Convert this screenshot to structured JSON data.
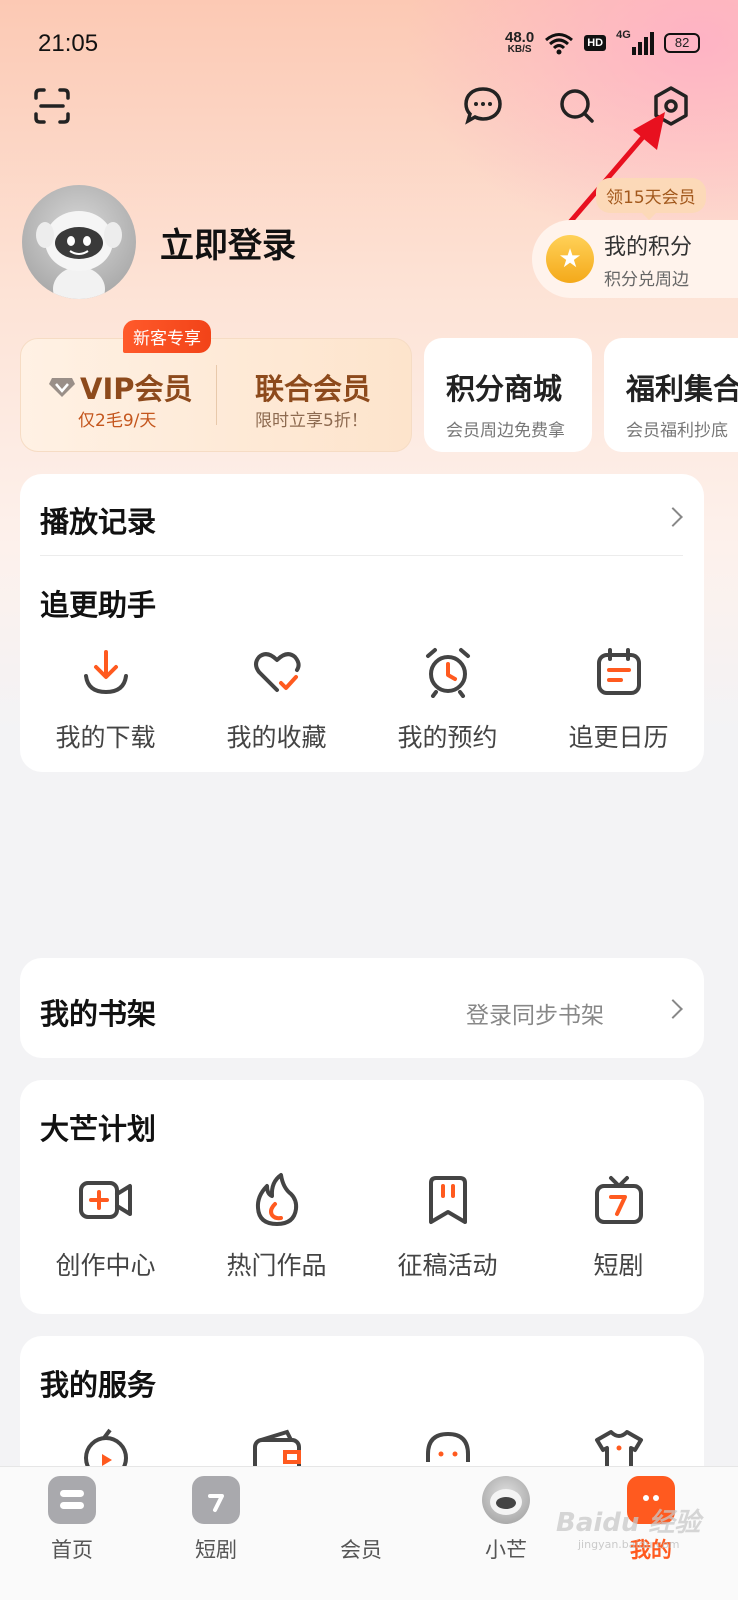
{
  "status_bar": {
    "time": "21:05",
    "net_speed_value": "48.0",
    "net_speed_unit": "KB/S",
    "hd_label": "HD",
    "network": "4G",
    "battery": "82"
  },
  "header": {
    "icons": [
      "scan-icon",
      "message-icon",
      "search-icon",
      "settings-icon"
    ]
  },
  "profile": {
    "login_text": "立即登录",
    "vip_tag": "领15天会员",
    "points_title": "我的积分",
    "points_sub": "积分兑周边"
  },
  "membership": {
    "newbie_badge": "新客专享",
    "vip_label": "VIP会员",
    "vip_sub": "仅2毛9/天",
    "union_label": "联合会员",
    "union_sub": "限时立享5折！",
    "mall_title": "积分商城",
    "mall_sub": "会员周边免费拿",
    "welfare_title": "福利集合",
    "welfare_sub": "会员福利抄底"
  },
  "history": {
    "title": "播放记录"
  },
  "assistant": {
    "title": "追更助手",
    "items": [
      {
        "label": "我的下载",
        "icon": "download-icon"
      },
      {
        "label": "我的收藏",
        "icon": "heart-check-icon"
      },
      {
        "label": "我的预约",
        "icon": "alarm-clock-icon"
      },
      {
        "label": "追更日历",
        "icon": "calendar-icon"
      }
    ]
  },
  "bookshelf": {
    "title": "我的书架",
    "action": "登录同步书架"
  },
  "plan": {
    "title": "大芒计划",
    "items": [
      {
        "label": "创作中心",
        "icon": "video-add-icon"
      },
      {
        "label": "热门作品",
        "icon": "flame-icon"
      },
      {
        "label": "征稿活动",
        "icon": "bookmark-icon"
      },
      {
        "label": "短剧",
        "icon": "tv-seven-icon"
      }
    ]
  },
  "services": {
    "title": "我的服务"
  },
  "bottom_nav": [
    {
      "label": "首页",
      "icon": "home-icon"
    },
    {
      "label": "短剧",
      "icon": "short-drama-icon"
    },
    {
      "label": "会员",
      "icon": "member-icon"
    },
    {
      "label": "小芒",
      "icon": "xiaomang-icon"
    },
    {
      "label": "我的",
      "icon": "mine-icon",
      "active": true
    }
  ],
  "colors": {
    "accent": "#ff5a1f",
    "gold": "#8d4a1c",
    "annotation_arrow": "#e8101f"
  },
  "watermark": {
    "text": "Baidu 经验",
    "sub": "jingyan.baidu.com"
  }
}
